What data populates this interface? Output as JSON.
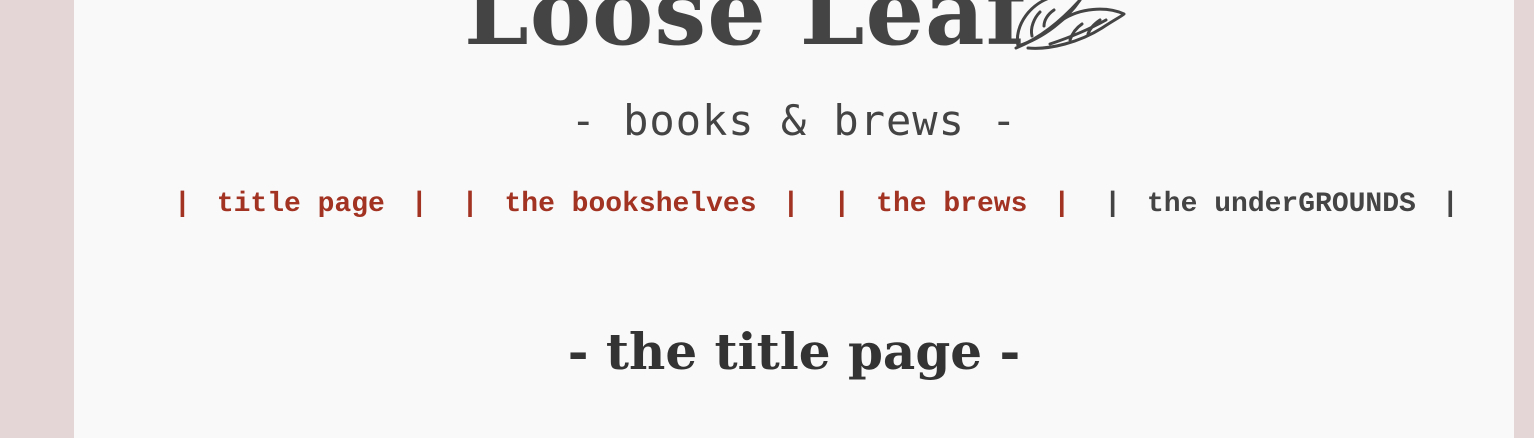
{
  "site": {
    "title": "Loose Leaf",
    "tagline": "- books & brews -"
  },
  "nav": {
    "items": [
      {
        "label": "title page"
      },
      {
        "label": "the bookshelves"
      },
      {
        "label": "the brews"
      },
      {
        "label": "the underGROUNDS"
      }
    ],
    "separator": "|"
  },
  "main": {
    "heading": "- the title page -"
  },
  "icons": {
    "logo": "leaf-icon"
  },
  "colors": {
    "background": "#e4d6d6",
    "page": "#f9f9f9",
    "link": "#a23222",
    "text": "#444444"
  }
}
